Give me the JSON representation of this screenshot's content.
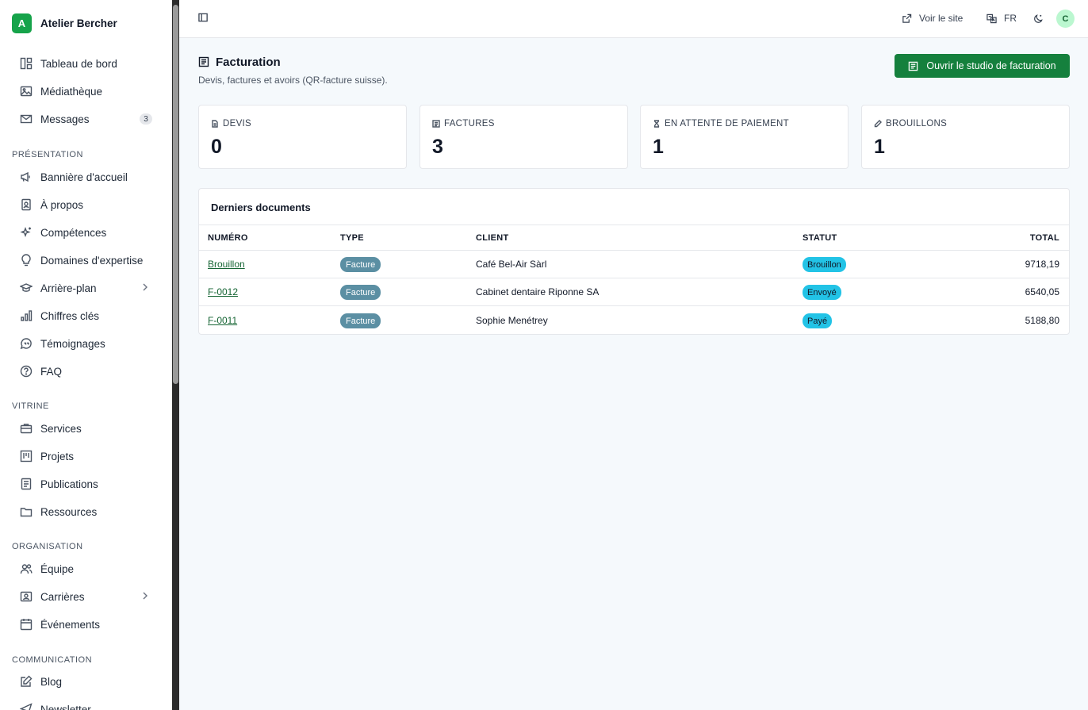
{
  "brand": {
    "initial": "A",
    "name": "Atelier Bercher"
  },
  "sidebar": {
    "top_items": [
      {
        "label": "Tableau de bord",
        "icon": "dashboard-icon"
      },
      {
        "label": "Médiathèque",
        "icon": "image-icon"
      },
      {
        "label": "Messages",
        "icon": "mail-icon",
        "badge": "3"
      }
    ],
    "sections": [
      {
        "title": "Présentation",
        "items": [
          {
            "label": "Bannière d'accueil",
            "icon": "megaphone-icon"
          },
          {
            "label": "À propos",
            "icon": "id-card-icon"
          },
          {
            "label": "Compétences",
            "icon": "sparkles-icon"
          },
          {
            "label": "Domaines d'expertise",
            "icon": "lightbulb-icon"
          },
          {
            "label": "Arrière-plan",
            "icon": "graduation-cap-icon",
            "expandable": true
          },
          {
            "label": "Chiffres clés",
            "icon": "bar-chart-icon"
          },
          {
            "label": "Témoignages",
            "icon": "quote-bubble-icon"
          },
          {
            "label": "FAQ",
            "icon": "help-circle-icon"
          }
        ]
      },
      {
        "title": "Vitrine",
        "items": [
          {
            "label": "Services",
            "icon": "briefcase-icon"
          },
          {
            "label": "Projets",
            "icon": "kanban-icon"
          },
          {
            "label": "Publications",
            "icon": "document-icon"
          },
          {
            "label": "Ressources",
            "icon": "folder-icon"
          }
        ]
      },
      {
        "title": "Organisation",
        "items": [
          {
            "label": "Équipe",
            "icon": "users-icon"
          },
          {
            "label": "Carrières",
            "icon": "contact-card-icon",
            "expandable": true
          },
          {
            "label": "Événements",
            "icon": "calendar-icon"
          }
        ]
      },
      {
        "title": "Communication",
        "items": [
          {
            "label": "Blog",
            "icon": "edit-icon"
          },
          {
            "label": "Newsletter",
            "icon": "send-icon"
          }
        ]
      }
    ]
  },
  "topbar": {
    "view_site": "Voir le site",
    "language": "FR",
    "avatar_initial": "C"
  },
  "page": {
    "title": "Facturation",
    "subtitle": "Devis, factures et avoirs (QR-facture suisse).",
    "primary_button": "Ouvrir le studio de facturation"
  },
  "stats": [
    {
      "label": "Devis",
      "value": "0",
      "icon": "file-icon"
    },
    {
      "label": "Factures",
      "value": "3",
      "icon": "receipt-icon"
    },
    {
      "label": "En attente de paiement",
      "value": "1",
      "icon": "hourglass-icon"
    },
    {
      "label": "Brouillons",
      "value": "1",
      "icon": "pencil-icon"
    }
  ],
  "documents": {
    "title": "Derniers documents",
    "columns": {
      "number": "Numéro",
      "type": "Type",
      "client": "Client",
      "status": "Statut",
      "total": "Total"
    },
    "rows": [
      {
        "number": "Brouillon",
        "type": "Facture",
        "client": "Café Bel-Air Sàrl",
        "status": "Brouillon",
        "total": "9718,19"
      },
      {
        "number": "F-0012",
        "type": "Facture",
        "client": "Cabinet dentaire Riponne SA",
        "status": "Envoyé",
        "total": "6540,05"
      },
      {
        "number": "F-0011",
        "type": "Facture",
        "client": "Sophie Menétrey",
        "status": "Payé",
        "total": "5188,80"
      }
    ]
  },
  "colors": {
    "accent": "#15803d",
    "type_pill": "#5b8fa3",
    "status_pill": "#22c3e6"
  }
}
